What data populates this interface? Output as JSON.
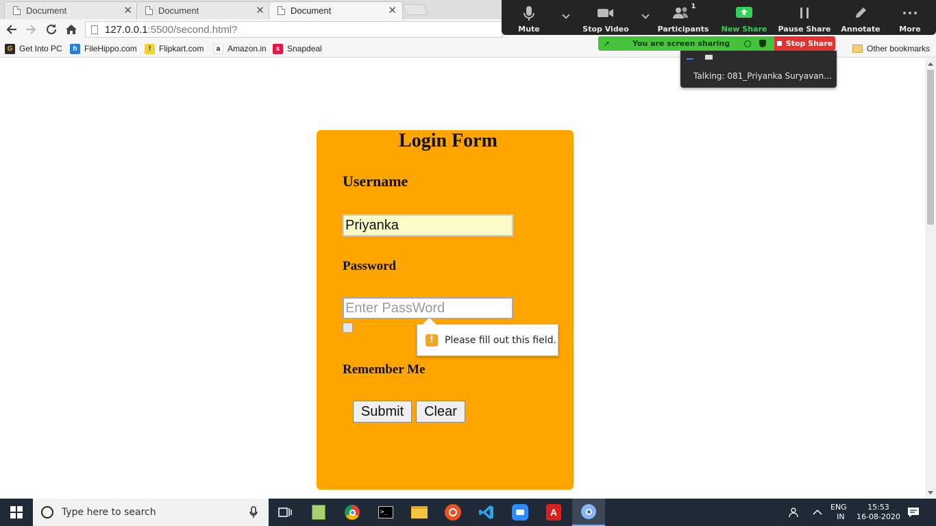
{
  "browser": {
    "tabs": [
      {
        "label": "Document",
        "active": false
      },
      {
        "label": "Document",
        "active": false
      },
      {
        "label": "Document",
        "active": true
      }
    ],
    "url_host": "127.0.0.1",
    "url_path": ":5500/second.html?",
    "bookmarks": [
      {
        "label": "Get Into PC",
        "icon": "getintopc-icon",
        "color": "#222222"
      },
      {
        "label": "FileHippo.com",
        "icon": "filehippo-icon",
        "color": "#2d7fd3"
      },
      {
        "label": "Flipkart.com",
        "icon": "flipkart-icon",
        "color": "#f7d325"
      },
      {
        "label": "Amazon.in",
        "icon": "amazon-icon",
        "color": "#ffffff"
      },
      {
        "label": "Snapdeal",
        "icon": "snapdeal-icon",
        "color": "#e5174a"
      }
    ],
    "other_bookmarks": "Other bookmarks"
  },
  "zoom": {
    "controls": [
      {
        "label": "Mute",
        "icon": "microphone-icon"
      },
      {
        "label": "Stop Video",
        "icon": "video-camera-icon"
      },
      {
        "label": "Participants",
        "icon": "participants-icon",
        "count": "1"
      },
      {
        "label": "New Share",
        "icon": "share-arrow-icon"
      },
      {
        "label": "Pause Share",
        "icon": "pause-icon"
      },
      {
        "label": "Annotate",
        "icon": "pencil-icon"
      },
      {
        "label": "More",
        "icon": "more-dots-icon"
      }
    ],
    "sharing_status": "You are screen sharing",
    "stop_share": "Stop Share",
    "talking": "Talking:  081_Priyanka  Suryavan..."
  },
  "form": {
    "title": "Login Form",
    "username_label": "Username",
    "username_value": "Priyanka",
    "password_label": "Password",
    "password_placeholder": "Enter PassWord",
    "remember_label": "Remember Me",
    "submit_label": "Submit",
    "clear_label": "Clear",
    "validation_message": "Please fill out this field.",
    "card_color": "#ffa500"
  },
  "taskbar": {
    "search_placeholder": "Type here to search",
    "language_top": "ENG",
    "language_bottom": "IN",
    "time": "15:53",
    "date": "16-08-2020"
  }
}
